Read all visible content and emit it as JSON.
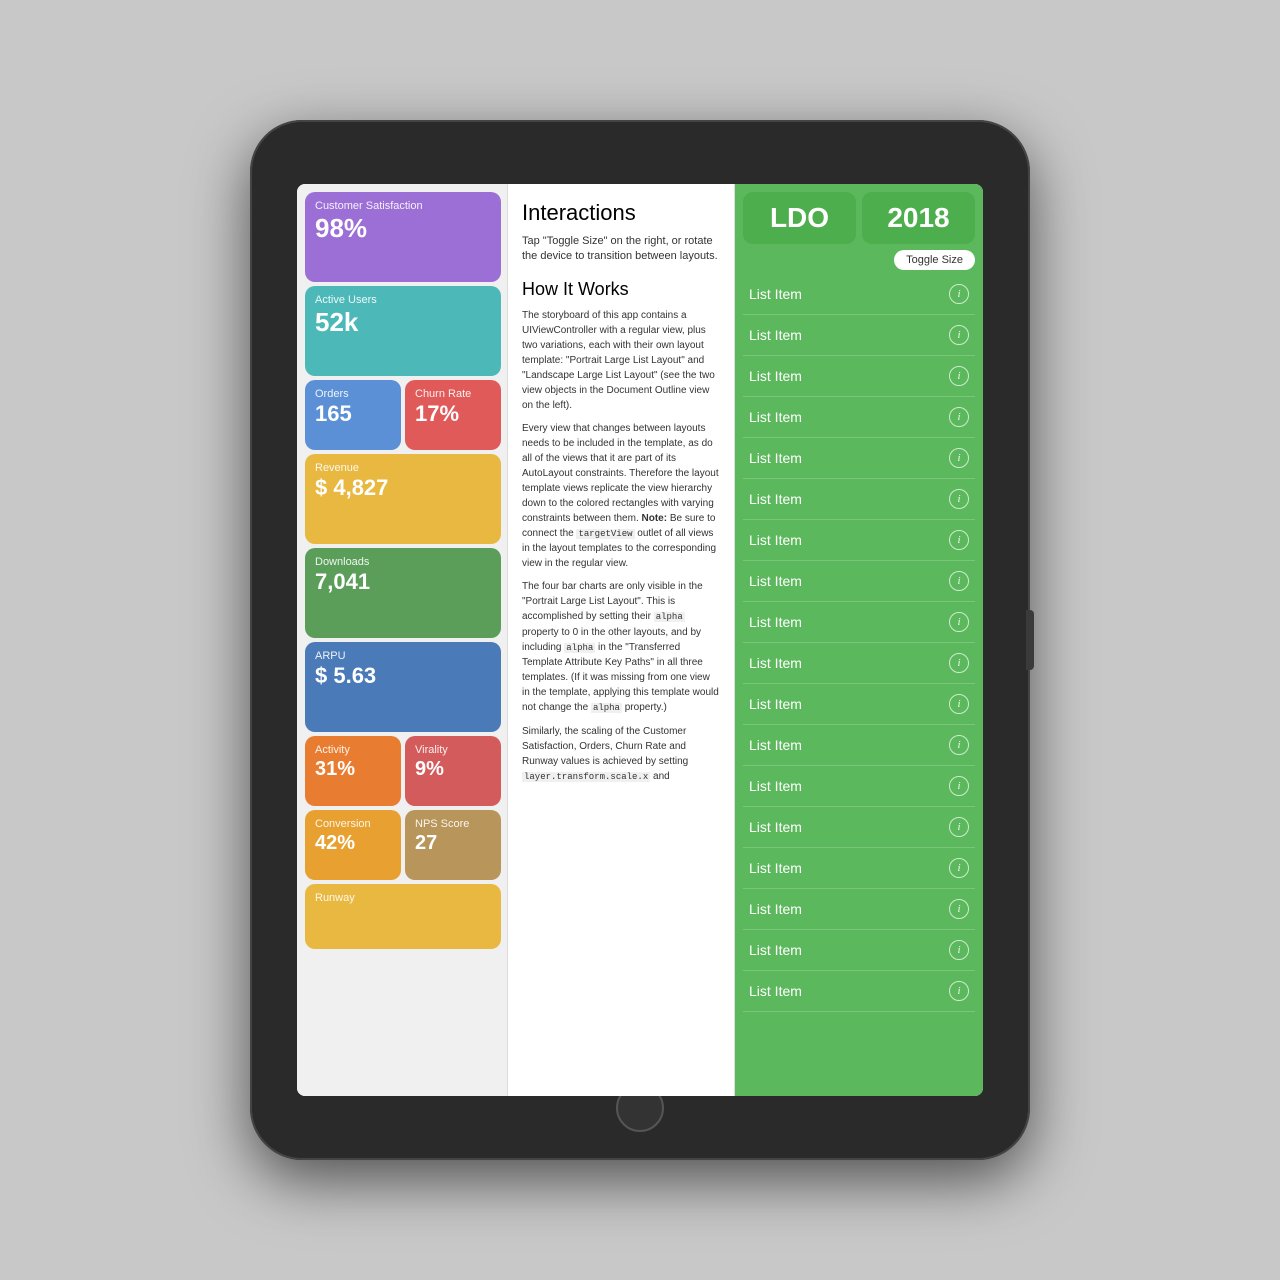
{
  "tablet": {
    "left_panel": {
      "cards": [
        {
          "id": "customer-satisfaction",
          "label": "Customer Satisfaction",
          "value": "98%",
          "color": "purple",
          "size": "large"
        },
        {
          "id": "active-users",
          "label": "Active Users",
          "value": "52k",
          "color": "teal",
          "size": "large"
        },
        {
          "id": "orders",
          "label": "Orders",
          "value": "165",
          "color": "blue",
          "size": "medium"
        },
        {
          "id": "churn-rate",
          "label": "Churn Rate",
          "value": "17%",
          "color": "red",
          "size": "medium"
        },
        {
          "id": "revenue",
          "label": "Revenue",
          "value": "$ 4,827",
          "color": "yellow",
          "size": "large"
        },
        {
          "id": "downloads",
          "label": "Downloads",
          "value": "7,041",
          "color": "green-dark",
          "size": "large"
        },
        {
          "id": "arpu",
          "label": "ARPU",
          "value": "$ 5.63",
          "color": "blue-dark",
          "size": "large"
        },
        {
          "id": "activity",
          "label": "Activity",
          "value": "31%",
          "color": "orange",
          "size": "medium"
        },
        {
          "id": "virality",
          "label": "Virality",
          "value": "9%",
          "color": "pink",
          "size": "medium"
        },
        {
          "id": "conversion",
          "label": "Conversion",
          "value": "42%",
          "color": "orange-amber",
          "size": "medium"
        },
        {
          "id": "nps-score",
          "label": "NPS Score",
          "value": "27",
          "color": "brown",
          "size": "medium"
        },
        {
          "id": "runway",
          "label": "Runway",
          "value": "",
          "color": "yellow",
          "size": "small"
        }
      ]
    },
    "middle_panel": {
      "title": "Interactions",
      "description": "Tap \"Toggle Size\" on the right, or rotate the device to transition between layouts.",
      "how_it_works_title": "How It Works",
      "body_paragraphs": [
        "The storyboard of this app contains a UIViewController with a regular view, plus two variations, each with their own layout template: \"Portrait Large List Layout\" and \"Landscape Large List Layout\" (see the two view objects in the Document Outline view on the left).",
        "Every view that changes between layouts needs to be included in the template, as do all of the views that it are part of its AutoLayout constraints. Therefore the layout template views replicate the view hierarchy down to the colored rectangles with varying constraints between them.",
        "Note: Be sure to connect the targetView outlet of all views in the layout templates to the corresponding view in the regular view.",
        "The four bar charts are only visible in the \"Portrait Large List Layout\". This is accomplished by setting their alpha property to 0 in the other layouts, and by including alpha in the \"Transferred Template Attribute Key Paths\" in all three templates. (If it was missing from one view in the template, applying this template would not change the alpha property.)",
        "Similarly, the scaling of the Customer Satisfaction, Orders, Churn Rate and Runway values is achieved by setting layer.transform.scale.x and"
      ]
    },
    "right_panel": {
      "badge1": "LDO",
      "badge2": "2018",
      "toggle_btn": "Toggle Size",
      "list_items": [
        "List Item",
        "List Item",
        "List Item",
        "List Item",
        "List Item",
        "List Item",
        "List Item",
        "List Item",
        "List Item",
        "List Item",
        "List Item",
        "List Item",
        "List Item",
        "List Item",
        "List Item",
        "List Item",
        "List Item",
        "List Item"
      ]
    }
  }
}
